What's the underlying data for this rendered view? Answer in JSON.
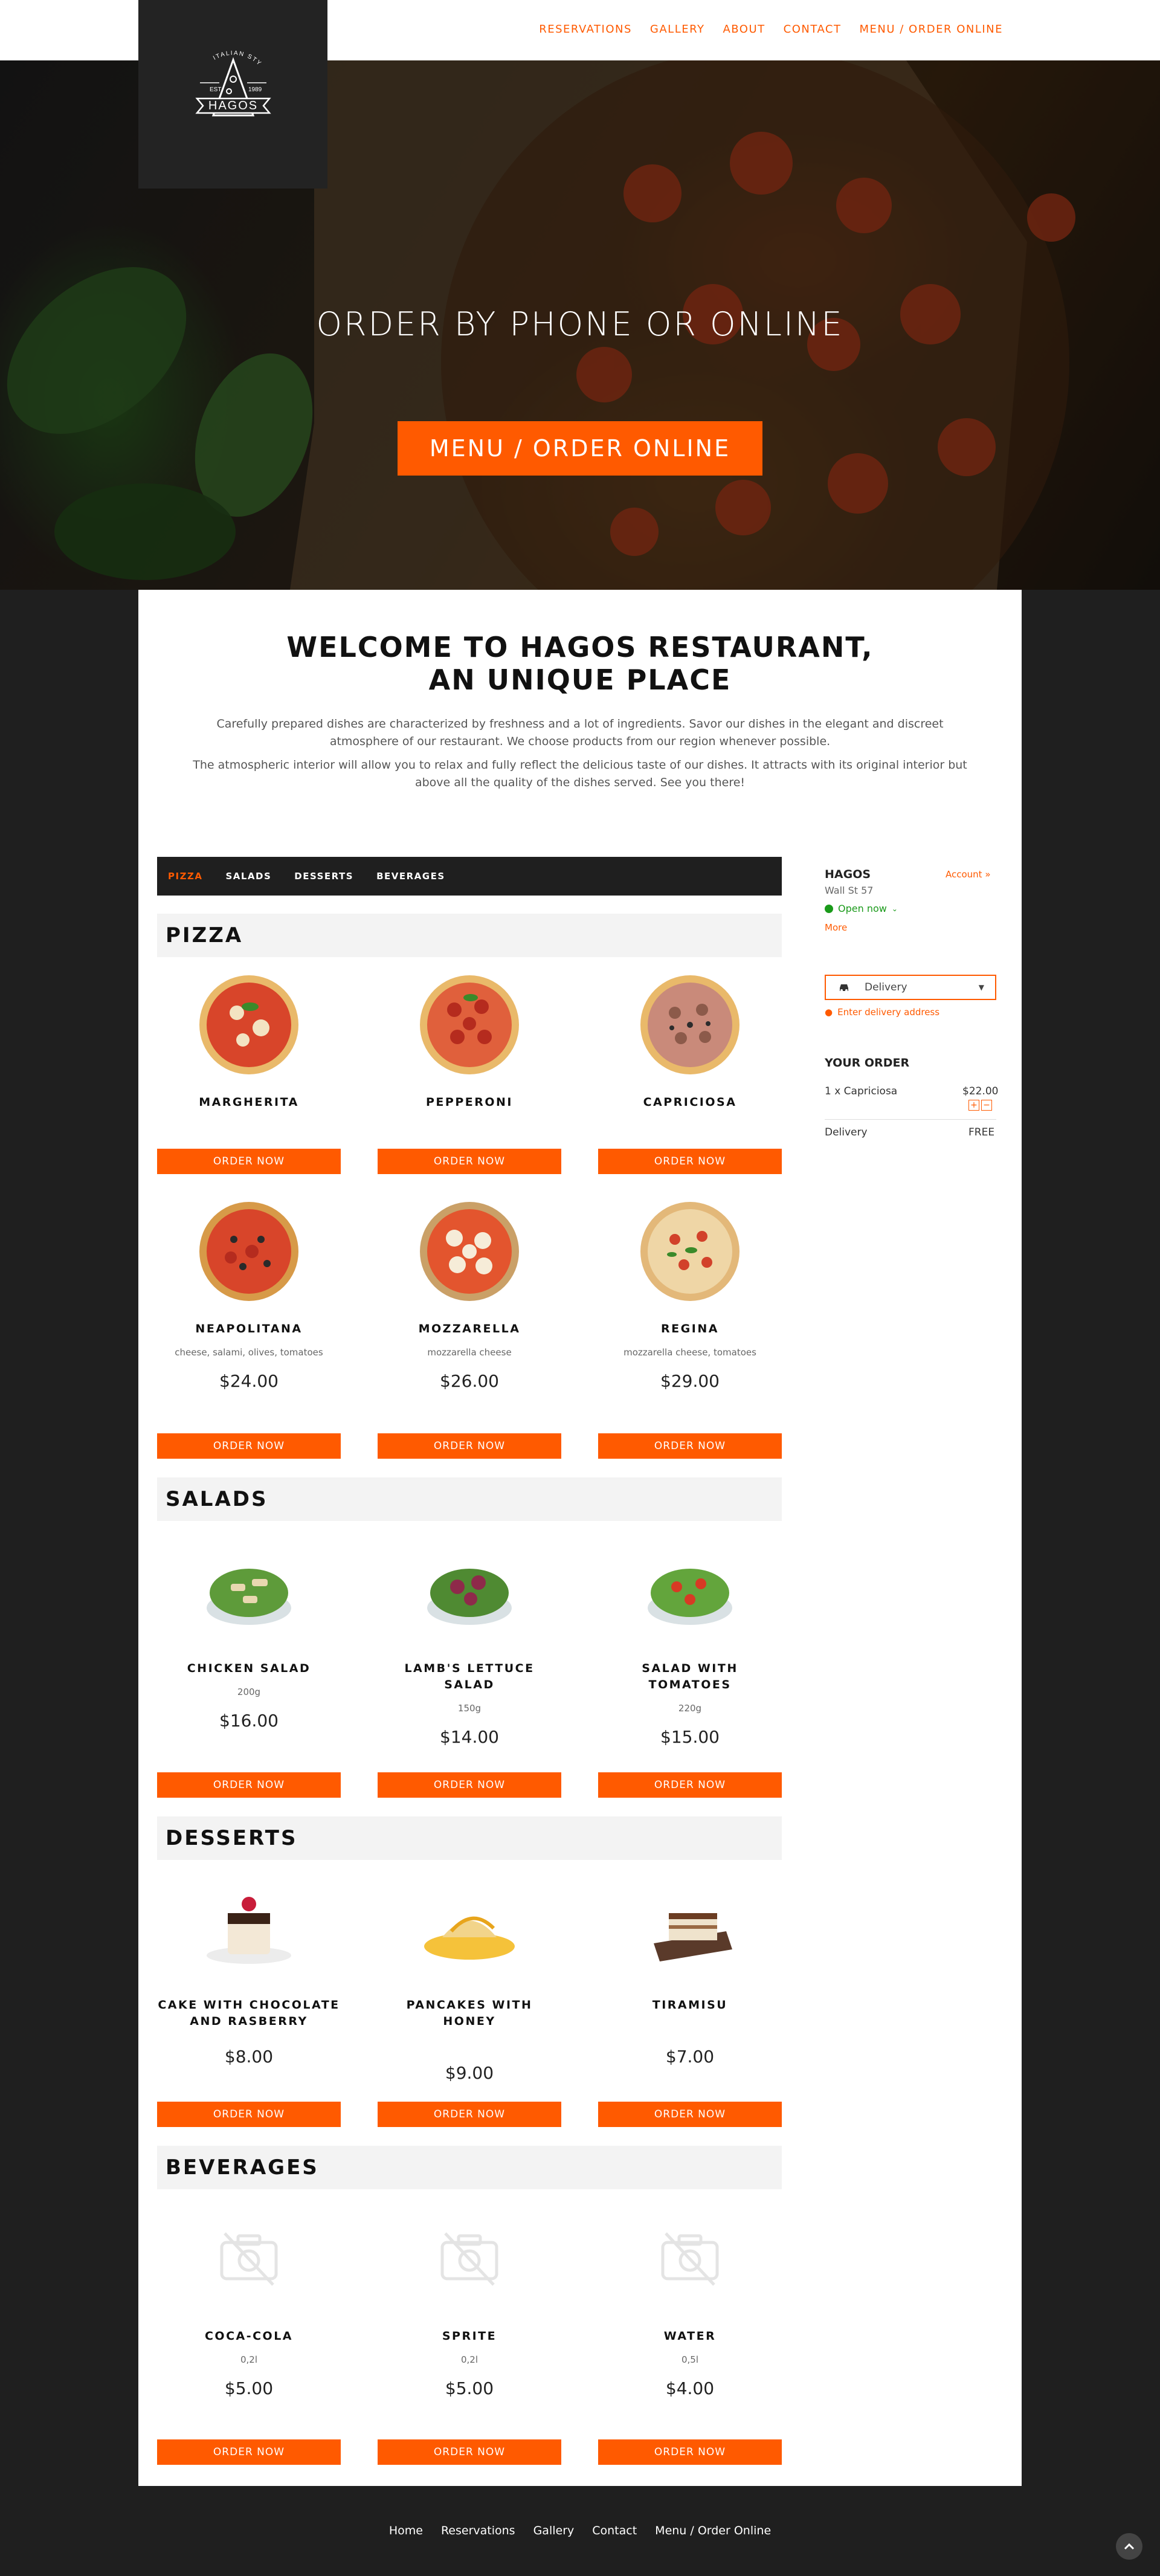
{
  "brand": {
    "logo_top_text": "ITALIAN STYLE",
    "logo_est": "EST.",
    "logo_year": "1989",
    "logo_name": "HAGOS"
  },
  "nav": [
    "RESERVATIONS",
    "GALLERY",
    "ABOUT",
    "CONTACT",
    "MENU / ORDER ONLINE"
  ],
  "hero": {
    "title": "ORDER BY PHONE OR ONLINE",
    "button": "MENU / ORDER ONLINE"
  },
  "welcome": {
    "title_line1": "WELCOME TO HAGOS RESTAURANT,",
    "title_line2": "AN UNIQUE PLACE",
    "p1": "Carefully prepared dishes are characterized by freshness and a lot of ingredients. Savor our dishes in the elegant and discreet atmosphere of our restaurant. We choose products from our region whenever possible.",
    "p2": "The atmospheric interior will allow you to relax and fully reflect the delicious taste of our dishes. It attracts with its original interior but above all the quality of the dishes served. See you there!"
  },
  "categories": [
    "PIZZA",
    "SALADS",
    "DESSERTS",
    "BEVERAGES"
  ],
  "order_button": "ORDER NOW",
  "sections": [
    {
      "title": "PIZZA",
      "items": [
        {
          "name": "MARGHERITA",
          "desc": "",
          "price": ""
        },
        {
          "name": "PEPPERONI",
          "desc": "",
          "price": ""
        },
        {
          "name": "CAPRICIOSA",
          "desc": "",
          "price": ""
        },
        {
          "name": "NEAPOLITANA",
          "desc": "cheese, salami, olives, tomatoes",
          "price": "$24.00"
        },
        {
          "name": "MOZZARELLA",
          "desc": "mozzarella cheese",
          "price": "$26.00"
        },
        {
          "name": "REGINA",
          "desc": "mozzarella cheese, tomatoes",
          "price": "$29.00"
        }
      ]
    },
    {
      "title": "SALADS",
      "items": [
        {
          "name": "CHICKEN SALAD",
          "desc": "200g",
          "price": "$16.00"
        },
        {
          "name": "LAMB'S LETTUCE SALAD",
          "desc": "150g",
          "price": "$14.00"
        },
        {
          "name": "SALAD WITH TOMATOES",
          "desc": "220g",
          "price": "$15.00"
        }
      ]
    },
    {
      "title": "DESSERTS",
      "items": [
        {
          "name": "CAKE WITH CHOCOLATE AND RASBERRY",
          "desc": "",
          "price": "$8.00"
        },
        {
          "name": "PANCAKES WITH HONEY",
          "desc": "",
          "price": "$9.00"
        },
        {
          "name": "TIRAMISU",
          "desc": "",
          "price": "$7.00"
        }
      ]
    },
    {
      "title": "BEVERAGES",
      "items": [
        {
          "name": "COCA-COLA",
          "desc": "0,2l",
          "price": "$5.00"
        },
        {
          "name": "SPRITE",
          "desc": "0,2l",
          "price": "$5.00"
        },
        {
          "name": "WATER",
          "desc": "0,5l",
          "price": "$4.00"
        }
      ]
    }
  ],
  "sidebar": {
    "name": "HAGOS",
    "account": "Account »",
    "address": "Wall St 57",
    "status": "Open now",
    "more": "More",
    "delivery_select": "Delivery",
    "enter_address": "Enter delivery address",
    "your_order": "YOUR ORDER",
    "order_line": "1 x Capriciosa",
    "order_price": "$22.00",
    "plus": "+",
    "minus": "−",
    "delivery_label": "Delivery",
    "delivery_value": "FREE"
  },
  "footer": [
    "Home",
    "Reservations",
    "Gallery",
    "Contact",
    "Menu / Order Online"
  ],
  "colors": {
    "accent": "#ff5a00",
    "dark": "#1f1f1f",
    "open": "#1a9a1a"
  }
}
